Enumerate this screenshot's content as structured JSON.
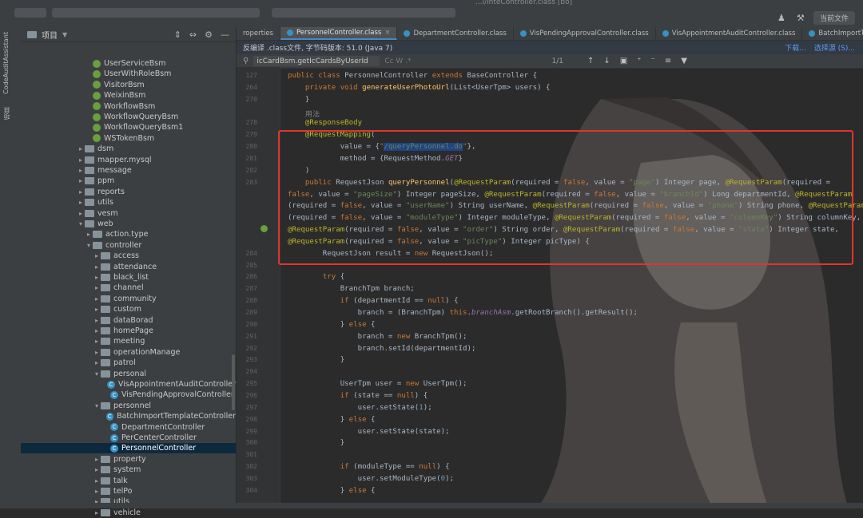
{
  "window": {
    "title_fragment": "...l/inteController.class [bo]",
    "run_config": "当前文件"
  },
  "toolstrip": {
    "tab1": "CodeAuditAssistant",
    "tab2": "项目"
  },
  "project": {
    "title": "项目",
    "tree": [
      {
        "label": "UserServiceBsm",
        "kind": "spring",
        "depth": 3
      },
      {
        "label": "UserWithRoleBsm",
        "kind": "spring",
        "depth": 3
      },
      {
        "label": "VisitorBsm",
        "kind": "spring",
        "depth": 3
      },
      {
        "label": "WeixinBsm",
        "kind": "spring",
        "depth": 3
      },
      {
        "label": "WorkflowBsm",
        "kind": "spring",
        "depth": 3
      },
      {
        "label": "WorkflowQueryBsm",
        "kind": "spring",
        "depth": 3
      },
      {
        "label": "WorkflowQueryBsm1",
        "kind": "spring",
        "depth": 3
      },
      {
        "label": "WSTokenBsm",
        "kind": "spring",
        "depth": 3
      },
      {
        "label": "dsm",
        "kind": "folder",
        "depth": 2
      },
      {
        "label": "mapper.mysql",
        "kind": "folder",
        "depth": 2
      },
      {
        "label": "message",
        "kind": "folder",
        "depth": 2
      },
      {
        "label": "ppm",
        "kind": "folder",
        "depth": 2
      },
      {
        "label": "reports",
        "kind": "folder",
        "depth": 2
      },
      {
        "label": "utils",
        "kind": "folder",
        "depth": 2
      },
      {
        "label": "vesm",
        "kind": "folder",
        "depth": 2
      },
      {
        "label": "web",
        "kind": "folder-open",
        "depth": 2
      },
      {
        "label": "action.type",
        "kind": "folder",
        "depth": 3
      },
      {
        "label": "controller",
        "kind": "folder-open",
        "depth": 3
      },
      {
        "label": "access",
        "kind": "folder",
        "depth": 4
      },
      {
        "label": "attendance",
        "kind": "folder",
        "depth": 4
      },
      {
        "label": "black_list",
        "kind": "folder",
        "depth": 4
      },
      {
        "label": "channel",
        "kind": "folder",
        "depth": 4
      },
      {
        "label": "community",
        "kind": "folder",
        "depth": 4
      },
      {
        "label": "custom",
        "kind": "folder",
        "depth": 4
      },
      {
        "label": "dataBorad",
        "kind": "folder",
        "depth": 4
      },
      {
        "label": "homePage",
        "kind": "folder",
        "depth": 4
      },
      {
        "label": "meeting",
        "kind": "folder",
        "depth": 4
      },
      {
        "label": "operationManage",
        "kind": "folder",
        "depth": 4
      },
      {
        "label": "patrol",
        "kind": "folder",
        "depth": 4
      },
      {
        "label": "personal",
        "kind": "folder-open",
        "depth": 4
      },
      {
        "label": "VisAppointmentAuditController",
        "kind": "class",
        "depth": 5
      },
      {
        "label": "VisPendingApprovalController",
        "kind": "class",
        "depth": 5
      },
      {
        "label": "personnel",
        "kind": "folder-open",
        "depth": 4
      },
      {
        "label": "BatchImportTemplateController",
        "kind": "class",
        "depth": 5
      },
      {
        "label": "DepartmentController",
        "kind": "class",
        "depth": 5
      },
      {
        "label": "PerCenterController",
        "kind": "class",
        "depth": 5
      },
      {
        "label": "PersonnelController",
        "kind": "class",
        "depth": 5,
        "selected": true
      },
      {
        "label": "property",
        "kind": "folder",
        "depth": 4
      },
      {
        "label": "system",
        "kind": "folder",
        "depth": 4
      },
      {
        "label": "talk",
        "kind": "folder",
        "depth": 4
      },
      {
        "label": "telPo",
        "kind": "folder",
        "depth": 4
      },
      {
        "label": "utils",
        "kind": "folder",
        "depth": 4
      },
      {
        "label": "vehicle",
        "kind": "folder",
        "depth": 4
      }
    ]
  },
  "tabs": [
    {
      "label": "roperties",
      "active": false
    },
    {
      "label": "PersonnelController.class",
      "active": true
    },
    {
      "label": "DepartmentController.class",
      "active": false
    },
    {
      "label": "VisPendingApprovalController.class",
      "active": false
    },
    {
      "label": "VisAppointmentAuditController.class",
      "active": false
    },
    {
      "label": "BatchImportTemplateContr",
      "active": false
    }
  ],
  "notice": {
    "text": "反编译 .class文件, 字节码版本: 51.0 (Java 7)",
    "download": "下载...",
    "choose_source": "选择源 (S)..."
  },
  "find": {
    "query": "icCardBsm.getIcCardsByUserId",
    "options": "Cc  W  .*",
    "count": "1/1"
  },
  "code_lines": [
    {
      "n": "127",
      "html": "<span class=\"kw\">public class</span> PersonnelController <span class=\"kw\">extends</span> BaseController {"
    },
    {
      "n": "264",
      "html": "    <span class=\"kw\">private void</span> <span class=\"fn\">generateUserPhotoUrl</span>(List&lt;UserTpm&gt; users) {"
    },
    {
      "n": "270",
      "html": "    }"
    },
    {
      "n": "",
      "html": "    <span style=\"color:#808080\">用法</span>"
    },
    {
      "n": "278",
      "html": "    <span class=\"an\">@ResponseBody</span>"
    },
    {
      "n": "279",
      "html": "    <span class=\"an\">@RequestMapping</span>("
    },
    {
      "n": "280",
      "html": "            value = {<span class=\"st\">\"<span class=\"hl\">/queryPersonnel.do</span>\"</span>},"
    },
    {
      "n": "281",
      "html": "            method = {RequestMethod.<span class=\"it\">GET</span>}"
    },
    {
      "n": "282",
      "html": "    )"
    },
    {
      "n": "283",
      "html": "    <span class=\"kw\">public</span> RequestJson <span class=\"fn\">queryPersonnel</span>(<span class=\"an\">@RequestParam</span>(required = <span class=\"kw\">false</span>, value = <span class=\"st\">\"page\"</span>) Integer page, <span class=\"an\">@RequestParam</span>(required ="
    },
    {
      "n": "",
      "html": "<span class=\"kw\">false</span>, value = <span class=\"st\">\"pageSize\"</span>) Integer pageSize, <span class=\"an\">@RequestParam</span>(required = <span class=\"kw\">false</span>, value = <span class=\"st\">\"branchId\"</span>) Long departmentId, <span class=\"an\">@RequestParam</span>"
    },
    {
      "n": "",
      "html": "(required = <span class=\"kw\">false</span>, value = <span class=\"st\">\"userName\"</span>) String userName, <span class=\"an\">@RequestParam</span>(required = <span class=\"kw\">false</span>, value = <span class=\"st\">\"phone\"</span>) String phone, <span class=\"an\">@RequestParam</span>"
    },
    {
      "n": "",
      "html": "(required = <span class=\"kw\">false</span>, value = <span class=\"st\">\"moduleType\"</span>) Integer moduleType, <span class=\"an\">@RequestParam</span>(required = <span class=\"kw\">false</span>, value = <span class=\"st\">\"columnKey\"</span>) String columnKey,"
    },
    {
      "n": "",
      "html": "<span class=\"an\">@RequestParam</span>(required = <span class=\"kw\">false</span>, value = <span class=\"st\">\"order\"</span>) String order, <span class=\"an\">@RequestParam</span>(required = <span class=\"kw\">false</span>, value = <span class=\"st\">\"state\"</span>) Integer state,"
    },
    {
      "n": "",
      "html": "<span class=\"an\">@RequestParam</span>(required = <span class=\"kw\">false</span>, value = <span class=\"st\">\"picType\"</span>) Integer picType) {"
    },
    {
      "n": "284",
      "html": "        RequestJson result = <span class=\"kw\">new</span> RequestJson();"
    },
    {
      "n": "285",
      "html": ""
    },
    {
      "n": "286",
      "html": "        <span class=\"kw\">try</span> {"
    },
    {
      "n": "287",
      "html": "            BranchTpm branch;"
    },
    {
      "n": "288",
      "html": "            <span class=\"kw\">if</span> (departmentId == <span class=\"kw\">null</span>) {"
    },
    {
      "n": "289",
      "html": "                branch = (BranchTpm) <span class=\"kw\">this</span>.<span class=\"it\">branchAsm</span>.getRootBranch().getResult();"
    },
    {
      "n": "290",
      "html": "            } <span class=\"kw\">else</span> {"
    },
    {
      "n": "291",
      "html": "                branch = <span class=\"kw\">new</span> BranchTpm();"
    },
    {
      "n": "292",
      "html": "                branch.setId(departmentId);"
    },
    {
      "n": "293",
      "html": "            }"
    },
    {
      "n": "294",
      "html": ""
    },
    {
      "n": "295",
      "html": "            UserTpm user = <span class=\"kw\">new</span> UserTpm();"
    },
    {
      "n": "296",
      "html": "            <span class=\"kw\">if</span> (state == <span class=\"kw\">null</span>) {"
    },
    {
      "n": "297",
      "html": "                user.setState(<span style=\"color:#6897bb\">1</span>);"
    },
    {
      "n": "298",
      "html": "            } <span class=\"kw\">else</span> {"
    },
    {
      "n": "299",
      "html": "                user.setState(state);"
    },
    {
      "n": "300",
      "html": "            }"
    },
    {
      "n": "301",
      "html": ""
    },
    {
      "n": "302",
      "html": "            <span class=\"kw\">if</span> (moduleType == <span class=\"kw\">null</span>) {"
    },
    {
      "n": "303",
      "html": "                user.setModuleType(<span style=\"color:#6897bb\">0</span>);"
    },
    {
      "n": "304",
      "html": "            } <span class=\"kw\">else</span> {"
    }
  ]
}
